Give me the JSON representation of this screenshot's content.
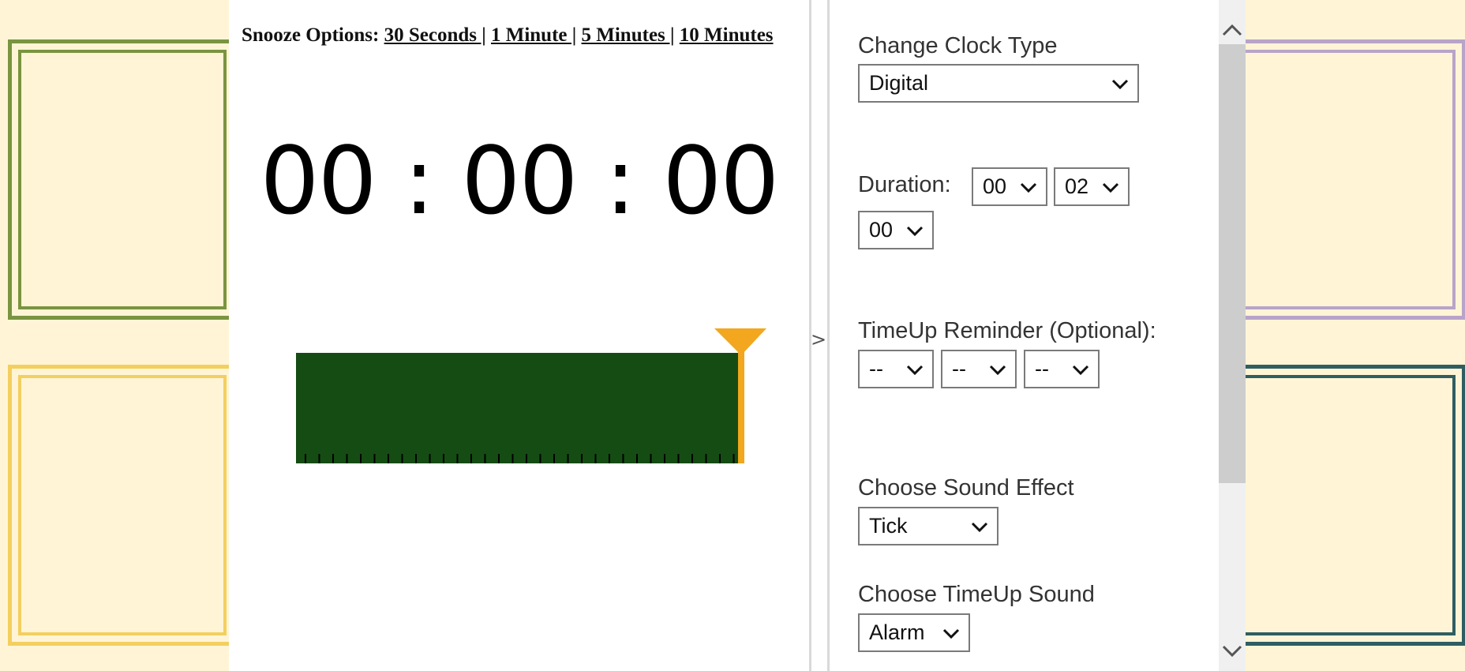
{
  "snooze": {
    "label": "Snooze Options:",
    "options": [
      "30 Seconds |",
      "1 Minute |",
      "5 Minutes |",
      "10 Minutes"
    ]
  },
  "clock": {
    "display": "00 : 00 : 00"
  },
  "progress": {
    "fraction": 1.0
  },
  "toggle": {
    "label": ">"
  },
  "settings": {
    "clock_type": {
      "label": "Change Clock Type",
      "value": "Digital"
    },
    "duration": {
      "label": "Duration:",
      "hours": "00",
      "minutes": "02",
      "seconds": "00"
    },
    "reminder": {
      "label": "TimeUp Reminder (Optional):",
      "hours": "--",
      "minutes": "--",
      "seconds": "--"
    },
    "sound_effect": {
      "label": "Choose Sound Effect",
      "value": "Tick"
    },
    "timeup_sound": {
      "label": "Choose TimeUp Sound",
      "value": "Alarm"
    }
  },
  "colors": {
    "background": "#fff5d6",
    "bar": "#154c14",
    "marker": "#f2a71f",
    "frame_green": "#7a9440",
    "frame_yellow": "#f3cf5f",
    "frame_purple": "#b9a3c9",
    "frame_teal": "#2f5e62"
  }
}
